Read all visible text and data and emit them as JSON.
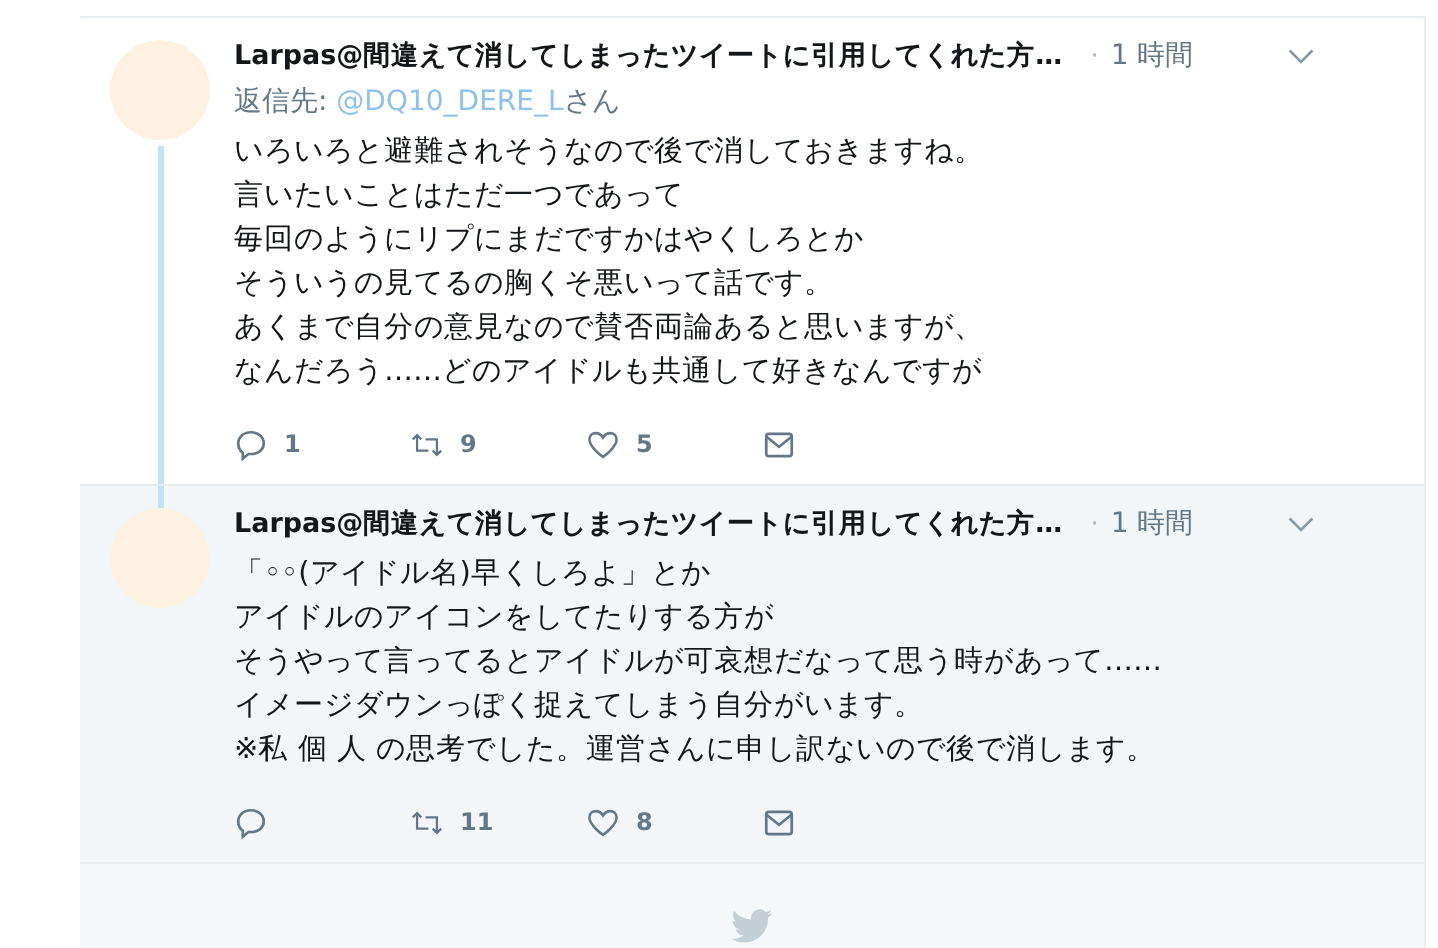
{
  "tweets": [
    {
      "name": "Larpas@間違えて消してしまったツイートに引用してくれた方…",
      "separator": "·",
      "time": "1 時間",
      "reply_to": {
        "prefix": "返信先: ",
        "handle": "@DQ10_DERE_L",
        "suffix": "さん"
      },
      "body": [
        "いろいろと避難されそうなので後で消しておきますね。",
        "言いたいことはただ一つであって",
        "毎回のようにリプにまだですかはやくしろとか",
        "そういうの見てるの胸くそ悪いって話です。",
        "あくまで自分の意見なので賛否両論あると思いますが、",
        "なんだろう……どのアイドルも共通して好きなんですが"
      ],
      "replies": "1",
      "retweets": "9",
      "likes": "5",
      "highlighted": false,
      "thread_continues": true
    },
    {
      "name": "Larpas@間違えて消してしまったツイートに引用してくれた方…",
      "separator": "·",
      "time": "1 時間",
      "body": [
        "「◦◦(アイドル名)早くしろよ」とか",
        "アイドルのアイコンをしてたりする方が",
        "そうやって言ってるとアイドルが可哀想だなって思う時があって……",
        "イメージダウンっぽく捉えてしまう自分がいます。",
        "※私 個 人 の思考でした。運営さんに申し訳ないので後で消します。"
      ],
      "retweets": "11",
      "likes": "8",
      "highlighted": true,
      "thread_continues": false
    }
  ]
}
